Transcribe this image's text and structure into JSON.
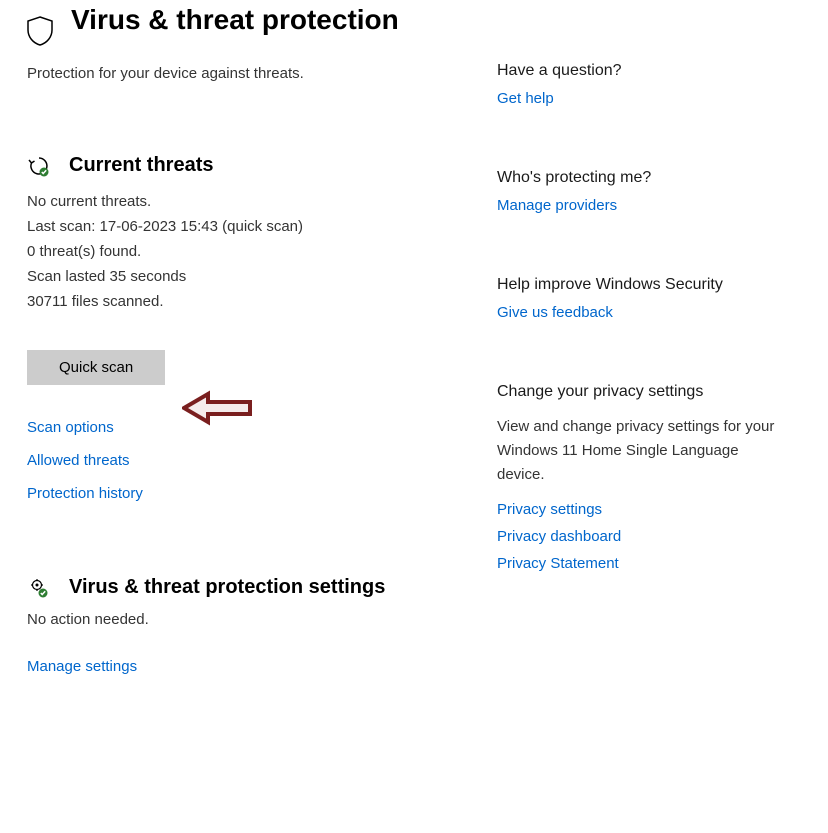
{
  "page": {
    "title": "Virus & threat protection",
    "subtitle": "Protection for your device against threats."
  },
  "threats": {
    "heading": "Current threats",
    "status_line": "No current threats.",
    "last_scan": "Last scan: 17-06-2023 15:43 (quick scan)",
    "found": "0 threat(s) found.",
    "duration": "Scan lasted 35 seconds",
    "files": "30711 files scanned.",
    "quick_scan_button": "Quick scan",
    "scan_options": "Scan options",
    "allowed_threats": "Allowed threats",
    "protection_history": "Protection history"
  },
  "settings": {
    "heading": "Virus & threat protection settings",
    "status": "No action needed.",
    "manage": "Manage settings"
  },
  "side": {
    "q1": {
      "heading": "Have a question?",
      "link": "Get help"
    },
    "q2": {
      "heading": "Who's protecting me?",
      "link": "Manage providers"
    },
    "q3": {
      "heading": "Help improve Windows Security",
      "link": "Give us feedback"
    },
    "q4": {
      "heading": "Change your privacy settings",
      "text": "View and change privacy settings for your Windows 11 Home Single Language device.",
      "link1": "Privacy settings",
      "link2": "Privacy dashboard",
      "link3": "Privacy Statement"
    }
  }
}
